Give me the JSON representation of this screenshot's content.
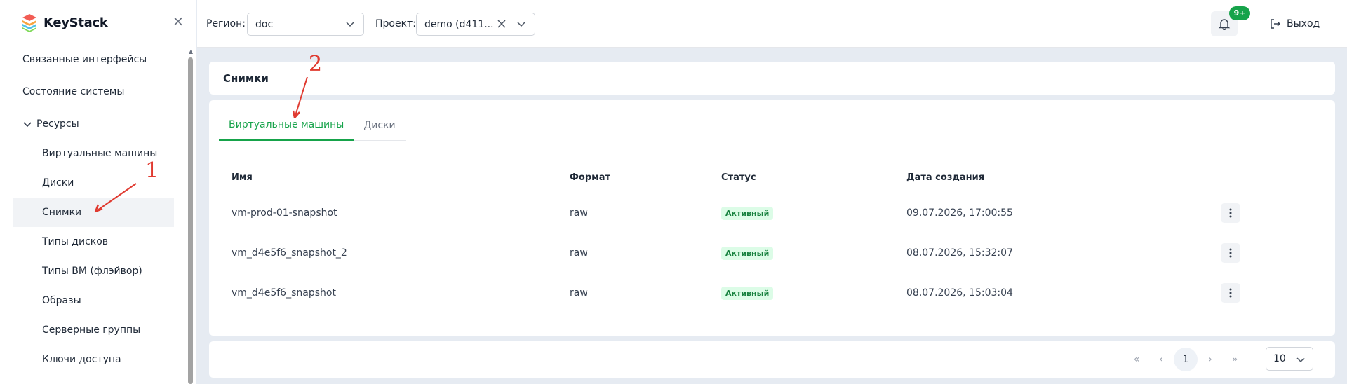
{
  "app": {
    "name": "KeyStack"
  },
  "sidebar": {
    "items": [
      {
        "label": "Связанные интерфейсы"
      },
      {
        "label": "Состояние системы"
      }
    ],
    "group": {
      "label": "Ресурсы",
      "children": [
        {
          "label": "Виртуальные машины"
        },
        {
          "label": "Диски"
        },
        {
          "label": "Снимки",
          "active": true
        },
        {
          "label": "Типы дисков"
        },
        {
          "label": "Типы ВМ (флэйвор)"
        },
        {
          "label": "Образы"
        },
        {
          "label": "Серверные группы"
        },
        {
          "label": "Ключи доступа"
        }
      ]
    }
  },
  "header": {
    "region_label": "Регион:",
    "region_value": "doc",
    "project_label": "Проект:",
    "project_value": "demo (d411...",
    "notifications_badge": "9+",
    "logout_label": "Выход"
  },
  "page": {
    "title": "Снимки",
    "tabs": [
      {
        "label": "Виртуальные машины",
        "active": true
      },
      {
        "label": "Диски",
        "active": false
      }
    ]
  },
  "table": {
    "columns": [
      "Имя",
      "Формат",
      "Статус",
      "Дата создания"
    ],
    "rows": [
      {
        "name": "vm-prod-01-snapshot",
        "format": "raw",
        "status": "Активный",
        "created": "09.07.2026, 17:00:55"
      },
      {
        "name": "vm_d4e5f6_snapshot_2",
        "format": "raw",
        "status": "Активный",
        "created": "08.07.2026, 15:32:07"
      },
      {
        "name": "vm_d4e5f6_snapshot",
        "format": "raw",
        "status": "Активный",
        "created": "08.07.2026, 15:03:04"
      }
    ]
  },
  "pagination": {
    "first": "«",
    "prev": "‹",
    "current_page": "1",
    "next": "›",
    "last": "»",
    "page_size": "10"
  },
  "annotations": [
    {
      "label": "1"
    },
    {
      "label": "2"
    }
  ],
  "colors": {
    "accent": "#16a34a",
    "annotation": "#e03a30",
    "background": "#e6ebf2"
  }
}
